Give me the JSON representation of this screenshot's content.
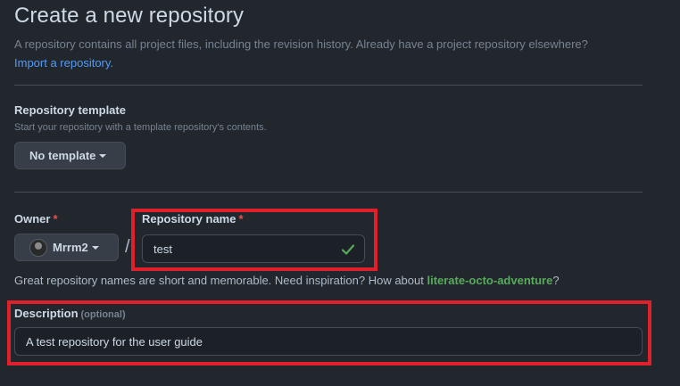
{
  "header": {
    "title": "Create a new repository",
    "subtitle": "A repository contains all project files, including the revision history. Already have a project repository elsewhere?",
    "import_link": "Import a repository."
  },
  "template": {
    "label": "Repository template",
    "hint": "Start your repository with a template repository's contents.",
    "button_label": "No template"
  },
  "owner": {
    "label": "Owner",
    "required_mark": "*",
    "value": "Mrrm2"
  },
  "slash": "/",
  "repo_name": {
    "label": "Repository name",
    "required_mark": "*",
    "value": "test"
  },
  "name_hint": {
    "text": "Great repository names are short and memorable. Need inspiration? How about ",
    "suggestion": "literate-octo-adventure",
    "end": "?"
  },
  "description": {
    "label": "Description",
    "optional_tag": "(optional)",
    "value": "A test repository for the user guide"
  },
  "colors": {
    "background": "#22272e",
    "accent_link": "#539bf5",
    "success": "#57ab5a",
    "required": "#e5534b",
    "highlight": "#e0202a"
  }
}
